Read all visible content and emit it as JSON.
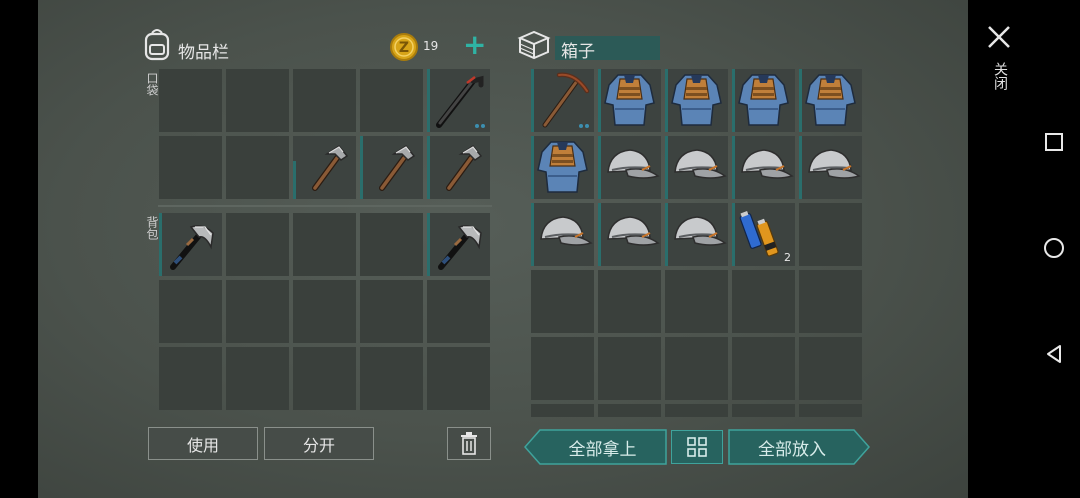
{
  "inventory": {
    "title": "物品栏",
    "coins": "19",
    "add_symbol": "+",
    "pocket_label": "口袋",
    "backpack_label": "背包"
  },
  "box": {
    "title": "箱子",
    "battery_qty": "2"
  },
  "buttons": {
    "use": "使用",
    "split": "分开",
    "take_all": "全部拿上",
    "put_all": "全部放入",
    "close_label": "关闭"
  },
  "colors": {
    "accent": "#2a6e6c",
    "button_teal": "#27635f",
    "plus_green": "#2fb3a4",
    "coin_gold": "#d7a418"
  },
  "icons": {
    "backpack": "backpack-icon",
    "box": "box-icon",
    "coin": "coin-icon",
    "trash": "trash-icon",
    "sort": "sort-icon",
    "close": "close-icon"
  }
}
